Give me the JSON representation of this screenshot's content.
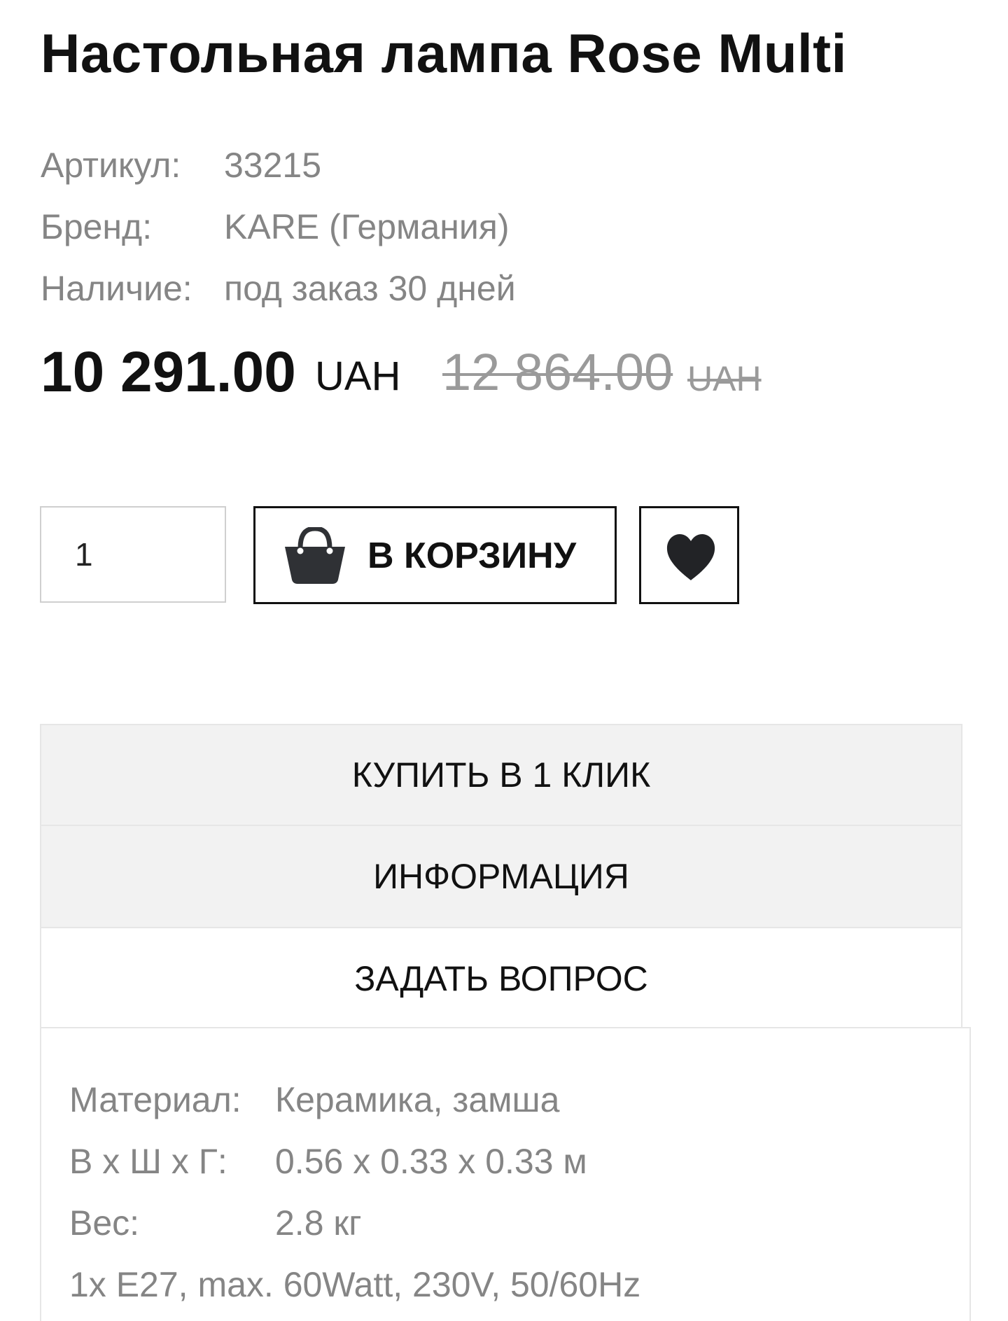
{
  "product": {
    "title": "Настольная лампа Rose Multi"
  },
  "meta": [
    {
      "label": "Артикул:",
      "value": "33215"
    },
    {
      "label": "Бренд:",
      "value": "KARE (Германия)"
    },
    {
      "label": "Наличие:",
      "value": "под заказ 30 дней"
    }
  ],
  "price": {
    "current": "10 291.00",
    "current_currency": "UAH",
    "old": "12 864.00",
    "old_currency": "UAH"
  },
  "purchase": {
    "quantity": "1",
    "cart_label": "В КОРЗИНУ",
    "cart_icon": "shopping-bag-icon",
    "favorite_icon": "heart-icon"
  },
  "accordion": [
    {
      "label": "КУПИТЬ В 1 КЛИК"
    },
    {
      "label": "ИНФОРМАЦИЯ"
    },
    {
      "label": "ЗАДАТЬ ВОПРОС"
    }
  ],
  "specs": [
    {
      "label": "Материал:",
      "value": "Керамика, замша"
    },
    {
      "label": "В х Ш х Г:",
      "value": "0.56 x 0.33 x 0.33 м"
    },
    {
      "label": "Вес:",
      "value": "2.8 кг"
    }
  ],
  "specs_note": "1x E27, max. 60Watt, 230V, 50/60Hz",
  "colors": {
    "text_dark": "#111111",
    "text_muted": "#858585",
    "accordion_bg": "#f2f2f2",
    "border_light": "#e6e6e6"
  }
}
